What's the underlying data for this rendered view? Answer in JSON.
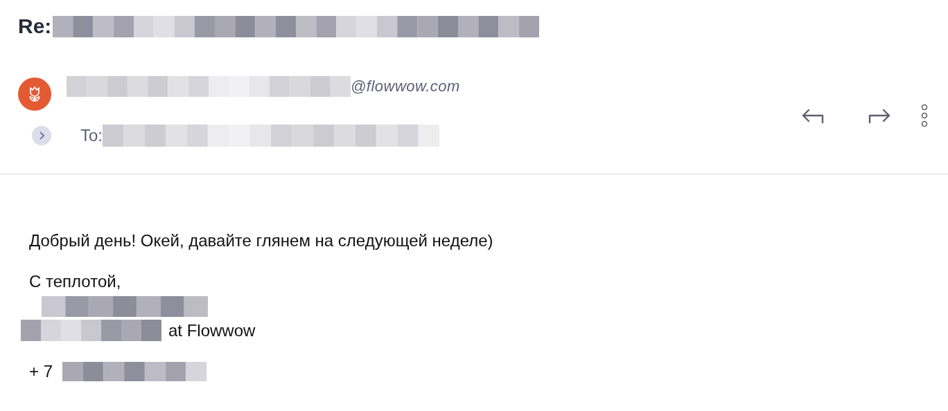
{
  "subject": {
    "prefix": "Re:"
  },
  "sender": {
    "domain": "@flowwow.com"
  },
  "recipient": {
    "label": "To:"
  },
  "body": [
    {
      "kind": "text",
      "text": "Добрый день! Окей, давайте глянем на следующей неделе)"
    },
    {
      "kind": "text",
      "text": "С теплотой,"
    },
    {
      "kind": "redacted"
    },
    {
      "kind": "redacted-prefix",
      "text": "at Flowwow"
    },
    {
      "kind": "text-prefix",
      "text": "+ 7"
    }
  ]
}
